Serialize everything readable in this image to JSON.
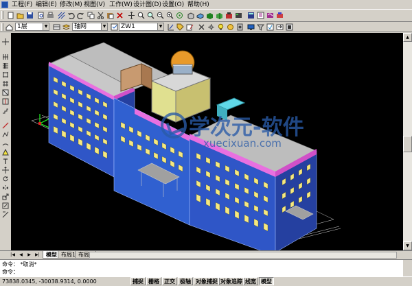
{
  "menu": [
    "工程(F)",
    "编辑(E)",
    "修改(M)",
    "视图(V)",
    "工作(W)",
    "设计图(D)",
    "设置(O)",
    "帮助(H)"
  ],
  "toolbar2": {
    "layer_combo": "1层",
    "linetype_combo": "轴网",
    "style_combo": "ZW1"
  },
  "watermark": {
    "text": "学次元-软件",
    "url": "xuecixuan.com"
  },
  "layout_tabs": [
    "模型",
    "布局1",
    "布局2"
  ],
  "command": {
    "line1_label": "命令：",
    "line1_text": "*取消*",
    "line2_label": "命令："
  },
  "status": {
    "coordinates": "73838.0345, -30038.9314, 0.0000",
    "toggles": [
      {
        "label": "捕捉",
        "on": false
      },
      {
        "label": "栅格",
        "on": false
      },
      {
        "label": "正交",
        "on": false
      },
      {
        "label": "极轴",
        "on": false
      },
      {
        "label": "对象捕捉",
        "on": false
      },
      {
        "label": "对象追踪",
        "on": false
      },
      {
        "label": "线宽",
        "on": false
      },
      {
        "label": "模型",
        "on": true
      }
    ]
  },
  "colors": {
    "viewport_bg": "#000000",
    "facade_blue": "#2f56c7",
    "roof_magenta": "#e870e0",
    "dome_orange": "#e89a2a",
    "watermark_blue": "#2a5ba8"
  }
}
